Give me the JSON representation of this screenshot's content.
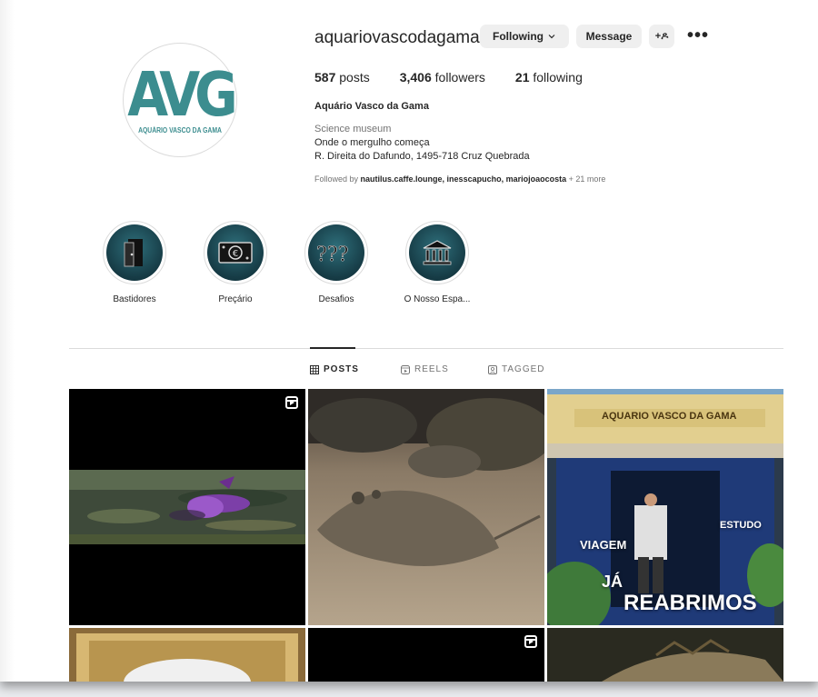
{
  "profile": {
    "username": "aquariovascodagama",
    "avatar_mark": "AVG",
    "avatar_subtitle": "AQUÁRIO VASCO DA GAMA",
    "following_button": "Following",
    "message_button": "Message",
    "add_user_glyph": "+ዶ",
    "more_glyph": "•••",
    "posts_count": "587",
    "posts_label": "posts",
    "followers_count": "3,406",
    "followers_label": "followers",
    "following_count": "21",
    "following_label": "following",
    "full_name": "Aquário Vasco da Gama",
    "category": "Science museum",
    "bio_line1": "Onde o mergulho começa",
    "bio_line2": "R. Direita do Dafundo, 1495-718 Cruz Quebrada",
    "followed_by_prefix": "Followed by",
    "followed_by_names": "nautilus.caffe.lounge, inesscapucho, mariojoaocosta",
    "followed_by_more": "+ 21 more",
    "brand_color": "#3c8d8f"
  },
  "highlights": [
    {
      "label": "Bastidores",
      "icon": "door-icon"
    },
    {
      "label": "Preçário",
      "icon": "euro-banknote-icon"
    },
    {
      "label": "Desafios",
      "icon": "question-marks-icon"
    },
    {
      "label": "O Nosso Espa...",
      "icon": "museum-building-icon"
    }
  ],
  "tabs": [
    {
      "label": "POSTS",
      "active": true,
      "icon": "grid-icon"
    },
    {
      "label": "REELS",
      "active": false,
      "icon": "reels-icon"
    },
    {
      "label": "TAGGED",
      "active": false,
      "icon": "tagged-icon"
    }
  ],
  "posts": {
    "post3_sign": "AQUARIO VASCO DA GAMA",
    "post3_word1": "VIAGEM",
    "post3_word2": "ESTUDO",
    "post3_word3": "JÁ",
    "post3_word4": "REABRIMOS"
  }
}
